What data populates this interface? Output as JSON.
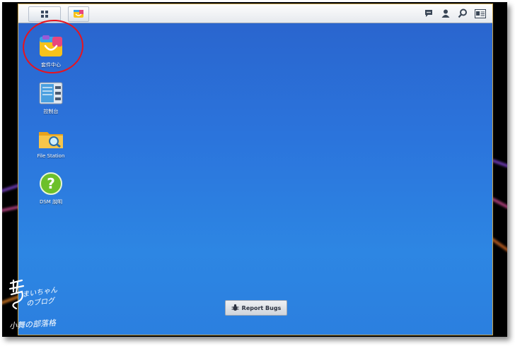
{
  "taskbar": {
    "main_menu_icon": "grid-menu-icon",
    "package_center_icon": "package-center-icon",
    "right_icons": [
      "chat-icon",
      "user-icon",
      "search-icon",
      "widgets-icon"
    ]
  },
  "desktop": {
    "icons": [
      {
        "label": "套件中心",
        "icon": "package-center-icon"
      },
      {
        "label": "控制台",
        "icon": "control-panel-icon"
      },
      {
        "label": "File Station",
        "icon": "folder-icon"
      },
      {
        "label": "DSM 說明",
        "icon": "help-icon"
      }
    ]
  },
  "report_bugs": {
    "label": "Report Bugs",
    "icon": "bug-icon"
  },
  "watermark": {
    "line1": "まいちゃん",
    "line2": "のブログ",
    "line3": "小舞の部落格"
  },
  "colors": {
    "desktop_top": "#2a63cc",
    "desktop_bottom": "#2d86e3",
    "highlight_circle": "#e8131e",
    "frame": "#c8a24a"
  }
}
